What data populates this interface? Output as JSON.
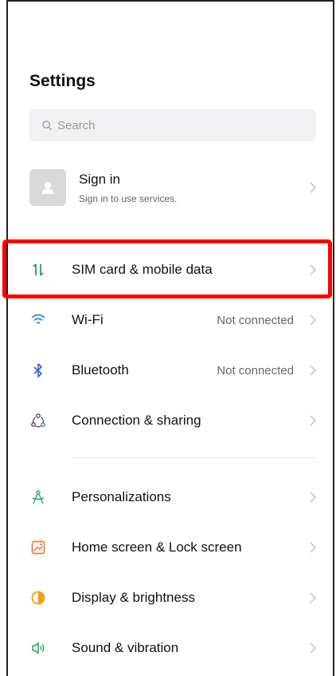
{
  "header": {
    "title": "Settings"
  },
  "search": {
    "placeholder": "Search"
  },
  "account": {
    "title": "Sign in",
    "subtitle": "Sign in to use services."
  },
  "rows": [
    {
      "label": "SIM card & mobile data",
      "value": ""
    },
    {
      "label": "Wi-Fi",
      "value": "Not connected"
    },
    {
      "label": "Bluetooth",
      "value": "Not connected"
    },
    {
      "label": "Connection & sharing",
      "value": ""
    },
    {
      "label": "Personalizations",
      "value": ""
    },
    {
      "label": "Home screen & Lock screen",
      "value": ""
    },
    {
      "label": "Display & brightness",
      "value": ""
    },
    {
      "label": "Sound & vibration",
      "value": ""
    }
  ],
  "colors": {
    "highlight": "#ff0000",
    "sim": "#22a35a",
    "wifi": "#2f7de1",
    "bluetooth": "#2f5fe0",
    "personalize": "#2bb35d",
    "homescreen": "#f07a3a",
    "display": "#f5a000",
    "sound": "#23b14d"
  }
}
